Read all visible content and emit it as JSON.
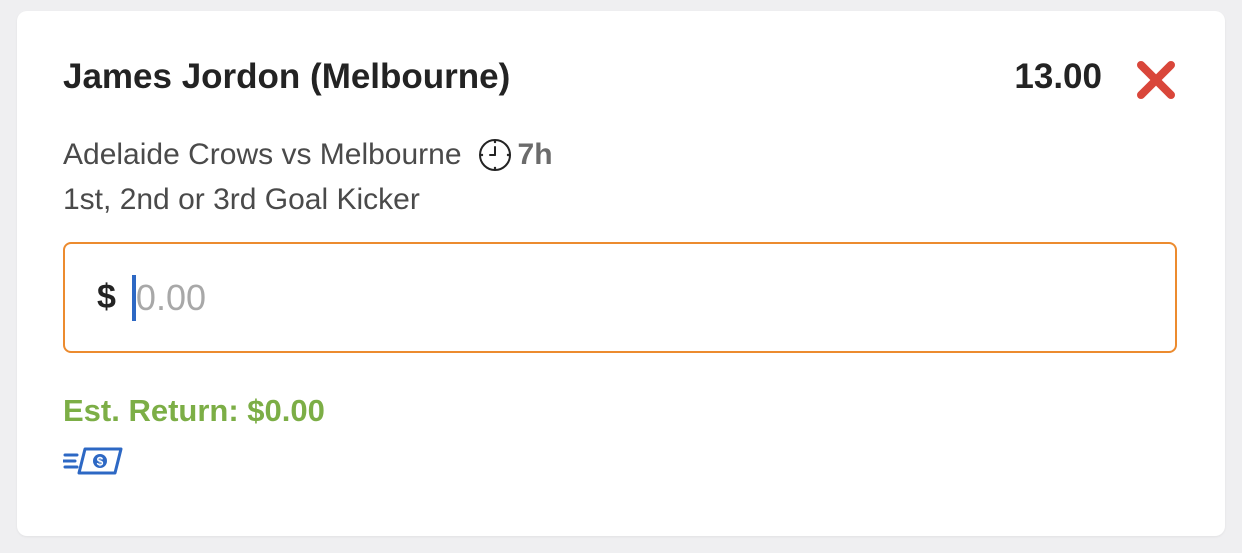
{
  "bet": {
    "selection": "James Jordon (Melbourne)",
    "odds": "13.00",
    "match": "Adelaide Crows vs Melbourne",
    "time_to_start": "7h",
    "market": "1st, 2nd or 3rd Goal Kicker"
  },
  "stake": {
    "currency_symbol": "$",
    "value": "",
    "placeholder": "0.00"
  },
  "est_return": "Est. Return: $0.00",
  "icons": {
    "remove": "close-icon",
    "clock": "clock-icon",
    "cash": "cash-out-icon"
  },
  "colors": {
    "remove": "#d9463a",
    "input_border": "#ec8b2f",
    "return_text": "#7cae46",
    "cash_icon": "#2d68c4",
    "caret": "#2d68c4"
  }
}
